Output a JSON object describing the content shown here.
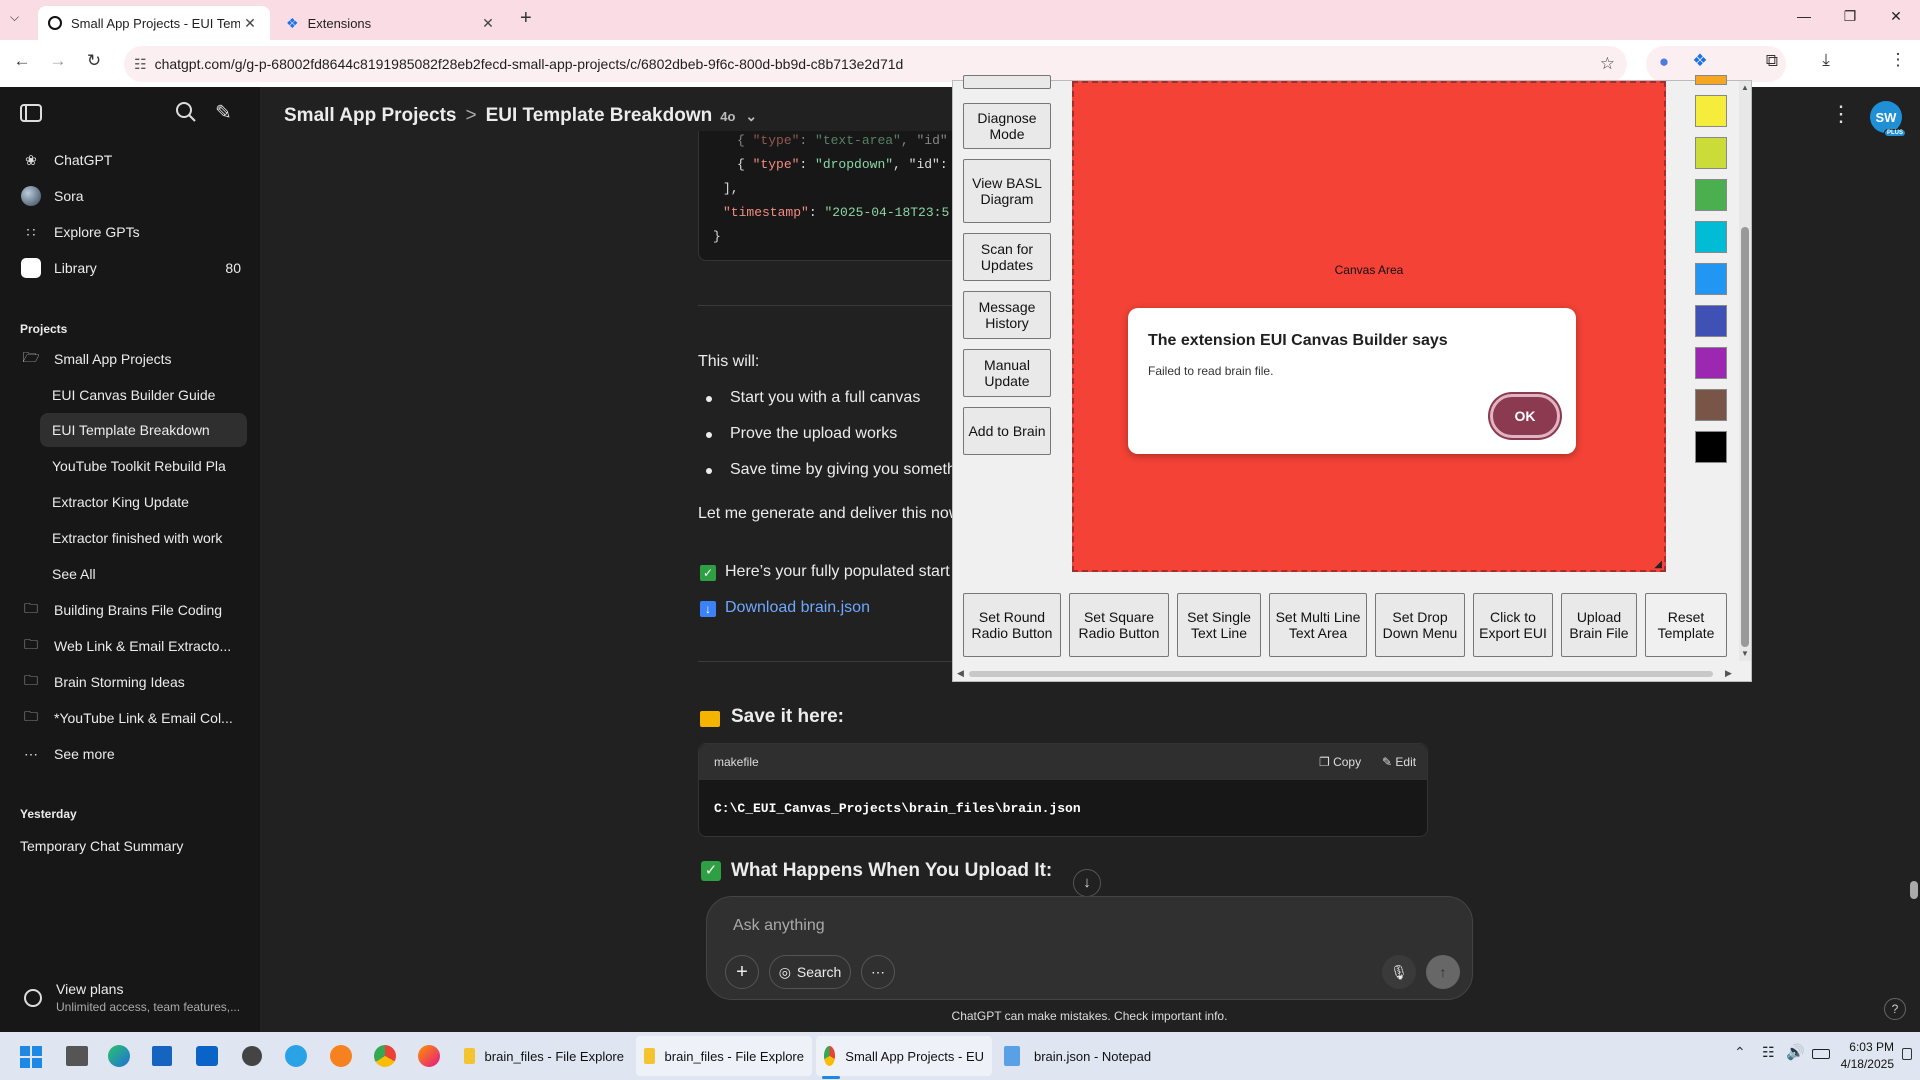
{
  "browser": {
    "tabs": [
      {
        "title": "Small App Projects - EUI Templ...",
        "active": true
      },
      {
        "title": "Extensions",
        "active": false
      }
    ],
    "url": "chatgpt.com/g/g-p-68002fd8644c8191985082f28eb2fecd-small-app-projects/c/6802dbeb-9f6c-800d-bb9d-c8b713e2d71d"
  },
  "sidebar": {
    "nav": [
      {
        "label": "ChatGPT",
        "icon": "openai-logo-icon"
      },
      {
        "label": "Sora",
        "icon": "sora-icon"
      },
      {
        "label": "Explore GPTs",
        "icon": "grid-icon"
      },
      {
        "label": "Library",
        "icon": "library-icon",
        "count": "80"
      }
    ],
    "projects_heading": "Projects",
    "project": "Small App Projects",
    "project_chats": [
      "EUI Canvas Builder Guide",
      "EUI Template Breakdown",
      "YouTube Toolkit Rebuild Pla",
      "Extractor King Update",
      "Extractor finished with work",
      "See All"
    ],
    "folders": [
      "Building Brains File Coding",
      "Web Link & Email Extracto...",
      "Brain Storming Ideas",
      "*YouTube Link & Email Col..."
    ],
    "see_more": "See more",
    "yesterday_heading": "Yesterday",
    "yesterday_items": [
      "Temporary Chat Summary"
    ],
    "view_plans": "View plans",
    "view_plans_sub": "Unlimited access, team features,..."
  },
  "header": {
    "project": "Small App Projects",
    "separator": ">",
    "chat": "EUI Template Breakdown",
    "model": "4o",
    "avatar": "SW",
    "avatar_badge": "PLUS"
  },
  "code_snippet": {
    "line1_key": "\"type\"",
    "line1_val": "\"text-area\"",
    "line1_rest": ", \"id\"",
    "line2_key": "\"type\"",
    "line2_val": "\"dropdown\"",
    "line2_rest": ", \"id\":",
    "line3": "],",
    "line4_key": "\"timestamp\"",
    "line4_val": "\"2025-04-18T23:5",
    "line5": "}"
  },
  "message": {
    "intro": "This will:",
    "bullets": [
      "Start you with a full canvas",
      "Prove the upload works",
      "Save time by giving you someth"
    ],
    "generate": "Let me generate and deliver this now",
    "populated": "Here’s your fully populated start",
    "download": "Download brain.json",
    "save_heading": "Save it here:",
    "save_lang": "makefile",
    "copy": "Copy",
    "edit": "Edit",
    "save_path": "C:\\C_EUI_Canvas_Projects\\brain_files\\brain.json",
    "upload_heading": "What Happens When You Upload It:"
  },
  "extension": {
    "left_buttons": [
      "Diagnose Mode",
      "View BASL Diagram",
      "Scan for Updates",
      "Message History",
      "Manual Update",
      "Add to Brain"
    ],
    "canvas_label": "Canvas Area",
    "bottom_buttons": [
      "Set Round Radio Button",
      "Set Square Radio Button",
      "Set Single Text Line",
      "Set Multi Line Text Area",
      "Set Drop Down Menu",
      "Click to Export EUI",
      "Upload Brain File",
      "Reset Template"
    ],
    "palette": [
      "#f5ec3b",
      "#cbdc38",
      "#4bae4f",
      "#00bcd4",
      "#2196f3",
      "#3f51b5",
      "#9c27b0",
      "#795548",
      "#000000"
    ],
    "canvas_color": "#f44236"
  },
  "dialog": {
    "title": "The extension EUI Canvas Builder says",
    "message": "Failed to read brain file.",
    "ok": "OK"
  },
  "composer": {
    "placeholder": "Ask anything",
    "search": "Search"
  },
  "footer_note": "ChatGPT can make mistakes. Check important info.",
  "help": "?",
  "taskbar": {
    "apps": [
      {
        "label": "brain_files - File Explore"
      },
      {
        "label": "brain_files - File Explore"
      },
      {
        "label": "Small App Projects - EU"
      },
      {
        "label": "brain.json - Notepad"
      }
    ],
    "time": "6:03 PM",
    "date": "4/18/2025"
  }
}
